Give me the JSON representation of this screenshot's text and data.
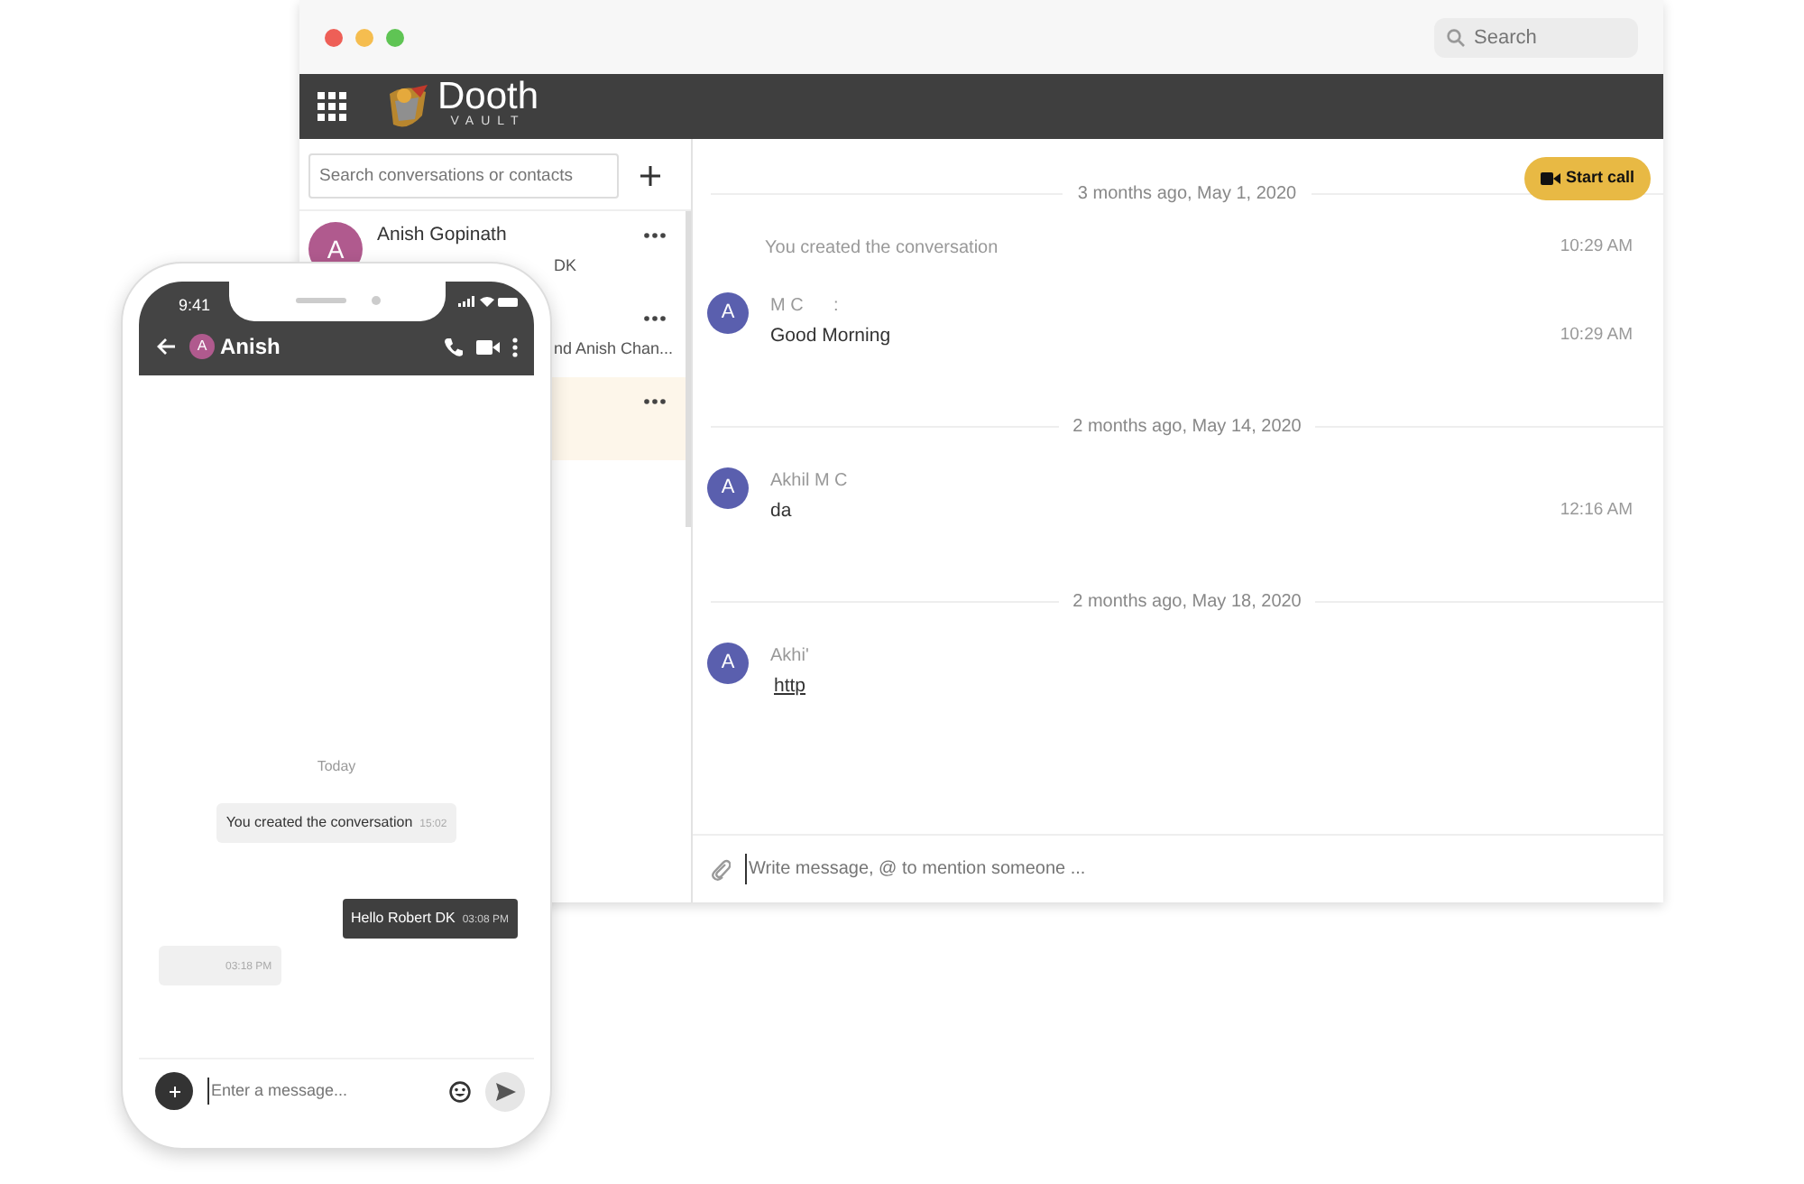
{
  "window": {
    "title_bar": {
      "search": {
        "placeholder": "Search"
      }
    },
    "header": {
      "logo": {
        "name": "Dooth",
        "tagline": "VAULT"
      }
    },
    "sidebar": {
      "search": {
        "placeholder": "Search conversations or contacts"
      },
      "items": [
        {
          "avatar": "A",
          "name": "Anish Gopinath",
          "preview": "DK",
          "selected": false
        },
        {
          "preview": "nd Anish Chan...",
          "selected": false
        },
        {
          "selected": true
        }
      ]
    },
    "chat": {
      "start_call": "Start call",
      "messages": [
        {
          "kind": "date",
          "text": "3 months ago, May 1, 2020"
        },
        {
          "kind": "system",
          "text": "You created the conversation",
          "time": "10:29 AM"
        },
        {
          "kind": "message",
          "avatar": "A",
          "sender": "M C      :",
          "text": "Good Morning",
          "time": "10:29 AM"
        },
        {
          "kind": "date",
          "text": "2 months ago, May 14, 2020"
        },
        {
          "kind": "message",
          "avatar": "A",
          "sender": "Akhil M C",
          "text": "da",
          "time": "12:16 AM"
        },
        {
          "kind": "date",
          "text": "2 months ago, May 18, 2020"
        },
        {
          "kind": "message",
          "avatar": "A",
          "sender": "Akhi'",
          "link": "http"
        }
      ],
      "composer": {
        "placeholder": "Write message, @ to mention someone ..."
      }
    }
  },
  "phone": {
    "status": {
      "time": "9:41"
    },
    "header": {
      "avatar": "A",
      "name": "Anish"
    },
    "messages": [
      {
        "kind": "day",
        "text": "Today"
      },
      {
        "kind": "system",
        "text": "You created the conversation",
        "time": "15:02"
      },
      {
        "kind": "outgoing",
        "text": "Hello Robert DK",
        "time": "03:08 PM"
      },
      {
        "kind": "incoming",
        "time": "03:18 PM"
      }
    ],
    "composer": {
      "placeholder": "Enter a message..."
    }
  }
}
